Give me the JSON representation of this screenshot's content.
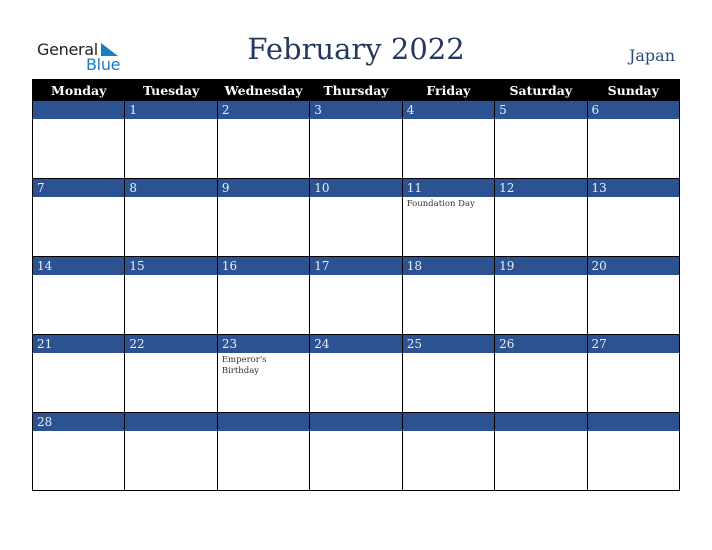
{
  "logo": {
    "line1": "General",
    "line2": "Blue"
  },
  "header": {
    "title": "February 2022",
    "country": "Japan"
  },
  "weekdays": [
    "Monday",
    "Tuesday",
    "Wednesday",
    "Thursday",
    "Friday",
    "Saturday",
    "Sunday"
  ],
  "weeks": [
    [
      {
        "day": "",
        "event": ""
      },
      {
        "day": "1",
        "event": ""
      },
      {
        "day": "2",
        "event": ""
      },
      {
        "day": "3",
        "event": ""
      },
      {
        "day": "4",
        "event": ""
      },
      {
        "day": "5",
        "event": ""
      },
      {
        "day": "6",
        "event": ""
      }
    ],
    [
      {
        "day": "7",
        "event": ""
      },
      {
        "day": "8",
        "event": ""
      },
      {
        "day": "9",
        "event": ""
      },
      {
        "day": "10",
        "event": ""
      },
      {
        "day": "11",
        "event": "Foundation Day"
      },
      {
        "day": "12",
        "event": ""
      },
      {
        "day": "13",
        "event": ""
      }
    ],
    [
      {
        "day": "14",
        "event": ""
      },
      {
        "day": "15",
        "event": ""
      },
      {
        "day": "16",
        "event": ""
      },
      {
        "day": "17",
        "event": ""
      },
      {
        "day": "18",
        "event": ""
      },
      {
        "day": "19",
        "event": ""
      },
      {
        "day": "20",
        "event": ""
      }
    ],
    [
      {
        "day": "21",
        "event": ""
      },
      {
        "day": "22",
        "event": ""
      },
      {
        "day": "23",
        "event": "Emperor's Birthday"
      },
      {
        "day": "24",
        "event": ""
      },
      {
        "day": "25",
        "event": ""
      },
      {
        "day": "26",
        "event": ""
      },
      {
        "day": "27",
        "event": ""
      }
    ],
    [
      {
        "day": "28",
        "event": ""
      },
      {
        "day": "",
        "event": ""
      },
      {
        "day": "",
        "event": ""
      },
      {
        "day": "",
        "event": ""
      },
      {
        "day": "",
        "event": ""
      },
      {
        "day": "",
        "event": ""
      },
      {
        "day": "",
        "event": ""
      }
    ]
  ],
  "colors": {
    "title": "#23395d",
    "band": "#2c5292",
    "header_bg": "#000000",
    "logo_blue": "#1a7cc1"
  }
}
